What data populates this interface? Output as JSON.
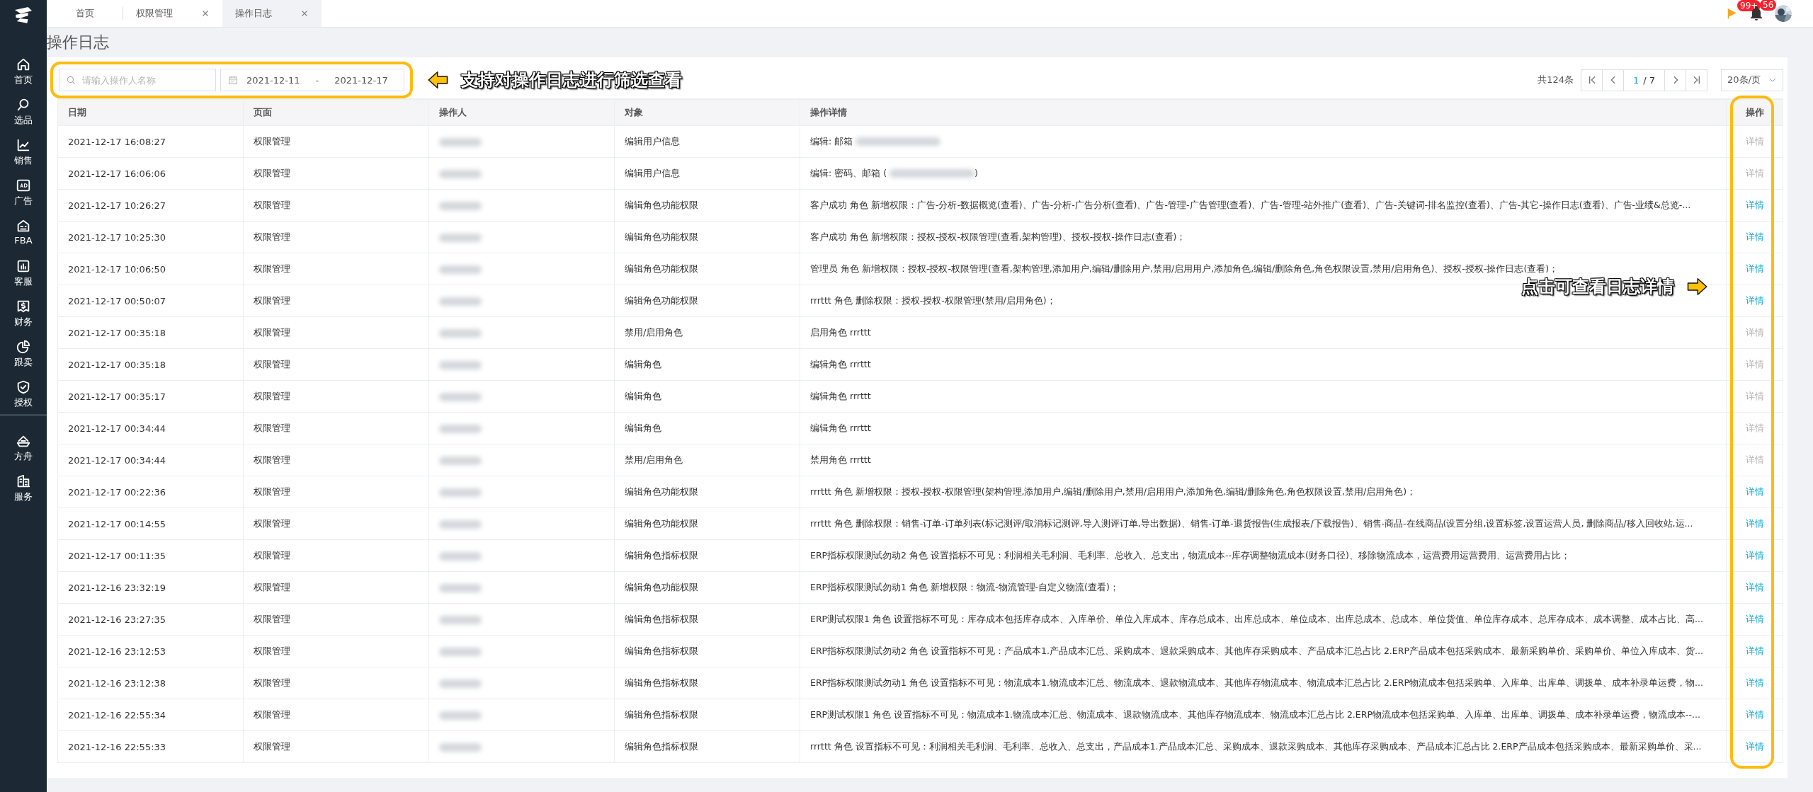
{
  "sidebar": {
    "items": [
      {
        "label": "首页"
      },
      {
        "label": "选品"
      },
      {
        "label": "销售"
      },
      {
        "label": "广告"
      },
      {
        "label": "FBA"
      },
      {
        "label": "客服"
      },
      {
        "label": "财务"
      },
      {
        "label": "跟卖"
      },
      {
        "label": "授权"
      },
      {
        "label": "方舟"
      },
      {
        "label": "服务"
      }
    ]
  },
  "tabs": [
    {
      "label": "首页",
      "closable": false,
      "selected": false
    },
    {
      "label": "权限管理",
      "closable": true,
      "selected": false
    },
    {
      "label": "操作日志",
      "closable": true,
      "selected": true
    }
  ],
  "header": {
    "flag_badge": "99+",
    "bell_badge": "56"
  },
  "page_title": "操作日志",
  "filter": {
    "search_placeholder": "请输入操作人名称",
    "date_start": "2021-12-11",
    "date_separator": "-",
    "date_end": "2021-12-17"
  },
  "pagination": {
    "total": "共124条",
    "current": "1",
    "pages": "/ 7",
    "page_size": "20条/页"
  },
  "table": {
    "columns": [
      "日期",
      "页面",
      "操作人",
      "对象",
      "操作详情",
      "操作"
    ],
    "rows": [
      {
        "date": "2021-12-17 16:08:27",
        "page": "权限管理",
        "target": "编辑用户信息",
        "detail": "编辑: 邮箱",
        "detail_redacted": true,
        "action": "详情",
        "action_disabled": true
      },
      {
        "date": "2021-12-17 16:06:06",
        "page": "权限管理",
        "target": "编辑用户信息",
        "detail": "编辑: 密码、邮箱 (",
        "detail_redacted": true,
        "detail_suffix": ")",
        "action": "详情",
        "action_disabled": true
      },
      {
        "date": "2021-12-17 10:26:27",
        "page": "权限管理",
        "target": "编辑角色功能权限",
        "detail": "客户成功 角色 新增权限：广告-分析-数据概览(查看)、广告-分析-广告分析(查看)、广告-管理-广告管理(查看)、广告-管理-站外推广(查看)、广告-关键词-排名监控(查看)、广告-其它-操作日志(查看)、广告-业绩&总览-...",
        "action": "详情",
        "action_disabled": false
      },
      {
        "date": "2021-12-17 10:25:30",
        "page": "权限管理",
        "target": "编辑角色功能权限",
        "detail": "客户成功 角色 新增权限：授权-授权-权限管理(查看,架构管理)、授权-授权-操作日志(查看)；",
        "action": "详情",
        "action_disabled": false
      },
      {
        "date": "2021-12-17 10:06:50",
        "page": "权限管理",
        "target": "编辑角色功能权限",
        "detail": "管理员 角色 新增权限：授权-授权-权限管理(查看,架构管理,添加用户,编辑/删除用户,禁用/启用用户,添加角色,编辑/删除角色,角色权限设置,禁用/启用角色)、授权-授权-操作日志(查看)；",
        "action": "详情",
        "action_disabled": false
      },
      {
        "date": "2021-12-17 00:50:07",
        "page": "权限管理",
        "target": "编辑角色功能权限",
        "detail": "rrrttt 角色 删除权限：授权-授权-权限管理(禁用/启用角色)；",
        "action": "详情",
        "action_disabled": false
      },
      {
        "date": "2021-12-17 00:35:18",
        "page": "权限管理",
        "target": "禁用/启用角色",
        "detail": "启用角色 rrrttt",
        "action": "详情",
        "action_disabled": true
      },
      {
        "date": "2021-12-17 00:35:18",
        "page": "权限管理",
        "target": "编辑角色",
        "detail": "编辑角色 rrrttt",
        "action": "详情",
        "action_disabled": true
      },
      {
        "date": "2021-12-17 00:35:17",
        "page": "权限管理",
        "target": "编辑角色",
        "detail": "编辑角色 rrrttt",
        "action": "详情",
        "action_disabled": true
      },
      {
        "date": "2021-12-17 00:34:44",
        "page": "权限管理",
        "target": "编辑角色",
        "detail": "编辑角色 rrrttt",
        "action": "详情",
        "action_disabled": true
      },
      {
        "date": "2021-12-17 00:34:44",
        "page": "权限管理",
        "target": "禁用/启用角色",
        "detail": "禁用角色 rrrttt",
        "action": "详情",
        "action_disabled": true
      },
      {
        "date": "2021-12-17 00:22:36",
        "page": "权限管理",
        "target": "编辑角色功能权限",
        "detail": "rrrttt 角色 新增权限：授权-授权-权限管理(架构管理,添加用户,编辑/删除用户,禁用/启用用户,添加角色,编辑/删除角色,角色权限设置,禁用/启用角色)；",
        "action": "详情",
        "action_disabled": false
      },
      {
        "date": "2021-12-17 00:14:55",
        "page": "权限管理",
        "target": "编辑角色功能权限",
        "detail": "rrrttt 角色 删除权限：销售-订单-订单列表(标记测评/取消标记测评,导入测评订单,导出数据)、销售-订单-退货报告(生成报表/下载报告)、销售-商品-在线商品(设置分组,设置标签,设置运营人员, 删除商品/移入回收站,运...",
        "action": "详情",
        "action_disabled": false
      },
      {
        "date": "2021-12-17 00:11:35",
        "page": "权限管理",
        "target": "编辑角色指标权限",
        "detail": "ERP指标权限测试勿动2 角色 设置指标不可见：利润相关毛利润、毛利率、总收入、总支出，物流成本--库存调整物流成本(财务口径)、移除物流成本，运营费用运营费用、运营费用占比；",
        "action": "详情",
        "action_disabled": false
      },
      {
        "date": "2021-12-16 23:32:19",
        "page": "权限管理",
        "target": "编辑角色功能权限",
        "detail": "ERP指标权限测试勿动1 角色 新增权限：物流-物流管理-自定义物流(查看)；",
        "action": "详情",
        "action_disabled": false
      },
      {
        "date": "2021-12-16 23:27:35",
        "page": "权限管理",
        "target": "编辑角色指标权限",
        "detail": "ERP测试权限1 角色 设置指标不可见：库存成本包括库存成本、入库单价、单位入库成本、库存总成本、出库总成本、单位成本、出库总成本、总成本、单位货值、单位库存成本、总库存成本、成本调整、成本占比、高...",
        "action": "详情",
        "action_disabled": false
      },
      {
        "date": "2021-12-16 23:12:53",
        "page": "权限管理",
        "target": "编辑角色指标权限",
        "detail": "ERP指标权限测试勿动2 角色 设置指标不可见：产品成本1.产品成本汇总、采购成本、退款采购成本、其他库存采购成本、产品成本汇总占比 2.ERP产品成本包括采购成本、最新采购单价、采购单价、单位入库成本、货...",
        "action": "详情",
        "action_disabled": false
      },
      {
        "date": "2021-12-16 23:12:38",
        "page": "权限管理",
        "target": "编辑角色指标权限",
        "detail": "ERP指标权限测试勿动1 角色 设置指标不可见：物流成本1.物流成本汇总、物流成本、退款物流成本、其他库存物流成本、物流成本汇总占比 2.ERP物流成本包括采购单、入库单、出库单、调拨单、成本补录单运费，物...",
        "action": "详情",
        "action_disabled": false
      },
      {
        "date": "2021-12-16 22:55:34",
        "page": "权限管理",
        "target": "编辑角色指标权限",
        "detail": "ERP测试权限1 角色 设置指标不可见：物流成本1.物流成本汇总、物流成本、退款物流成本、其他库存物流成本、物流成本汇总占比 2.ERP物流成本包括采购单、入库单、出库单、调拨单、成本补录单运费，物流成本--...",
        "action": "详情",
        "action_disabled": false
      },
      {
        "date": "2021-12-16 22:55:33",
        "page": "权限管理",
        "target": "编辑角色指标权限",
        "detail": "rrrttt 角色 设置指标不可见：利润相关毛利润、毛利率、总收入、总支出，产品成本1.产品成本汇总、采购成本、退款采购成本、其他库存采购成本、产品成本汇总占比 2.ERP产品成本包括采购成本、最新采购单价、采...",
        "action": "详情",
        "action_disabled": false
      }
    ]
  },
  "annotations": [
    {
      "kind": "filter",
      "text": "支持对操作日志进行筛选查看"
    },
    {
      "kind": "action",
      "text": "点击可查看日志详情"
    }
  ]
}
